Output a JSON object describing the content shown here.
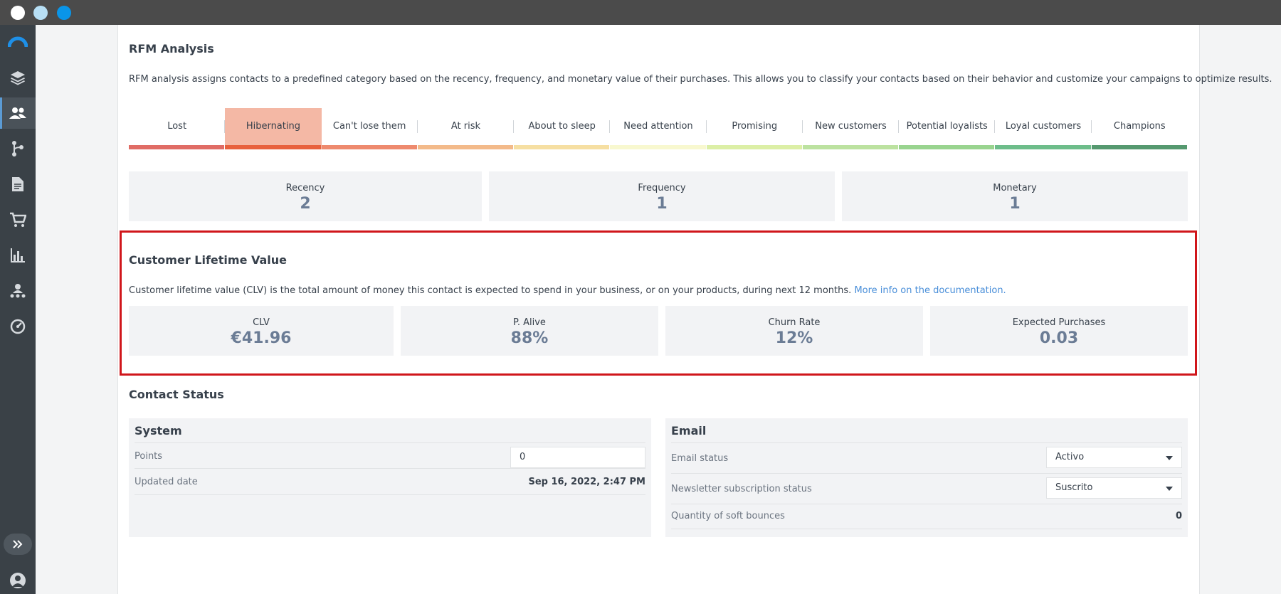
{
  "colors": {
    "tab_bars": [
      "#e06c65",
      "#e8613d",
      "#ee8a6e",
      "#f3ba8a",
      "#f6dfa2",
      "#f8f8cf",
      "#dcefa6",
      "#bce2a0",
      "#99d48f",
      "#6dbd8a",
      "#55996f"
    ],
    "hibernating_bg": "#f4b8a5",
    "accent": "#4a8fd9",
    "highlight_frame": "#d0161b"
  },
  "sidebar": {
    "icons": [
      "logo-icon",
      "layers-icon",
      "contacts-icon",
      "automation-icon",
      "document-icon",
      "cart-icon",
      "reports-icon",
      "audience-icon",
      "dashboard-icon"
    ],
    "expand_icon": "double-chevron-icon",
    "account_icon": "user-icon"
  },
  "rfm": {
    "title": "RFM Analysis",
    "description": "RFM analysis assigns contacts to a predefined category based on the recency, frequency, and monetary value of their purchases. This allows you to classify your contacts based on their behavior and customize your campaigns to optimize results.",
    "tabs": [
      "Lost",
      "Hibernating",
      "Can't lose them",
      "At risk",
      "About to sleep",
      "Need attention",
      "Promising",
      "New customers",
      "Potential loyalists",
      "Loyal customers",
      "Champions"
    ],
    "active_tab": "Hibernating",
    "recency": {
      "label": "Recency",
      "value": "2"
    },
    "frequency": {
      "label": "Frequency",
      "value": "1"
    },
    "monetary": {
      "label": "Monetary",
      "value": "1"
    }
  },
  "clv": {
    "title": "Customer Lifetime Value",
    "description": "Customer lifetime value (CLV) is the total amount of money this contact is expected to spend in your business, or on your products, during next 12 months.",
    "link": "More info on the documentation.",
    "clv": {
      "label": "CLV",
      "value": "€41.96"
    },
    "alive": {
      "label": "P. Alive",
      "value": "88%"
    },
    "churn": {
      "label": "Churn Rate",
      "value": "12%"
    },
    "purchases": {
      "label": "Expected Purchases",
      "value": "0.03"
    }
  },
  "contact_status": {
    "title": "Contact Status",
    "system": {
      "title": "System",
      "points_label": "Points",
      "points_value": "0",
      "updated_label": "Updated date",
      "updated_value": "Sep 16, 2022, 2:47 PM"
    },
    "email": {
      "title": "Email",
      "status_label": "Email status",
      "status_value": "Activo",
      "newsletter_label": "Newsletter subscription status",
      "newsletter_value": "Suscrito",
      "bounces_label": "Quantity of soft bounces",
      "bounces_value": "0"
    }
  }
}
